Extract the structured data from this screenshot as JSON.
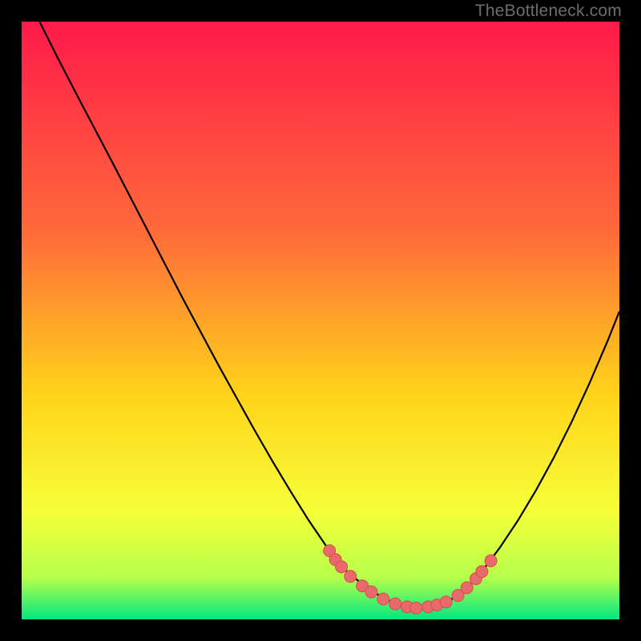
{
  "attribution": "TheBottleneck.com",
  "colors": {
    "frame": "#000000",
    "curve_stroke": "#000000",
    "marker_fill": "#e86a6a",
    "marker_stroke": "#d44d4d",
    "gradient_top": "#ff1a4a",
    "gradient_mid_upper": "#ff6a3a",
    "gradient_mid": "#ffd21a",
    "gradient_mid_lower": "#f6ff3a",
    "gradient_near_bottom": "#b6ff4a",
    "gradient_bottom": "#00e880"
  },
  "chart_data": {
    "type": "line",
    "title": "",
    "xlabel": "",
    "ylabel": "",
    "xlim": [
      0,
      100
    ],
    "ylim": [
      0,
      100
    ],
    "series": [
      {
        "name": "bottleneck-curve",
        "x": [
          3,
          6,
          9,
          12,
          15,
          18,
          21,
          24,
          27,
          30,
          33,
          36,
          39,
          42,
          45,
          48,
          51,
          52.5,
          54,
          55,
          56,
          57,
          58,
          59,
          60,
          61,
          62,
          63,
          64,
          65,
          66,
          67,
          68,
          69,
          70,
          71,
          72.5,
          74,
          77,
          80,
          83,
          86,
          89,
          92,
          95,
          98,
          100
        ],
        "y": [
          100,
          94,
          88.2,
          82.5,
          76.8,
          71,
          65.2,
          59.4,
          53.6,
          48,
          42.4,
          37,
          31.6,
          26.4,
          21.4,
          16.6,
          12.2,
          10.2,
          8.4,
          7.5,
          6.7,
          5.9,
          5.2,
          4.5,
          3.9,
          3.4,
          2.9,
          2.5,
          2.2,
          2.0,
          1.9,
          1.9,
          2.0,
          2.2,
          2.5,
          2.9,
          3.7,
          4.8,
          8.0,
          12.0,
          16.5,
          21.5,
          27.0,
          33.0,
          39.5,
          46.5,
          51.5
        ]
      }
    ],
    "markers": {
      "name": "highlight-points",
      "points": [
        {
          "x": 51.5,
          "y": 11.5
        },
        {
          "x": 52.5,
          "y": 10.0
        },
        {
          "x": 53.5,
          "y": 8.8
        },
        {
          "x": 55.0,
          "y": 7.2
        },
        {
          "x": 57.0,
          "y": 5.6
        },
        {
          "x": 58.5,
          "y": 4.6
        },
        {
          "x": 60.5,
          "y": 3.4
        },
        {
          "x": 62.5,
          "y": 2.6
        },
        {
          "x": 64.5,
          "y": 2.1
        },
        {
          "x": 66.0,
          "y": 1.9
        },
        {
          "x": 68.0,
          "y": 2.1
        },
        {
          "x": 69.5,
          "y": 2.4
        },
        {
          "x": 71.0,
          "y": 2.9
        },
        {
          "x": 73.0,
          "y": 4.0
        },
        {
          "x": 74.5,
          "y": 5.3
        },
        {
          "x": 76.0,
          "y": 6.8
        },
        {
          "x": 77.0,
          "y": 8.0
        },
        {
          "x": 78.5,
          "y": 9.8
        }
      ]
    }
  }
}
